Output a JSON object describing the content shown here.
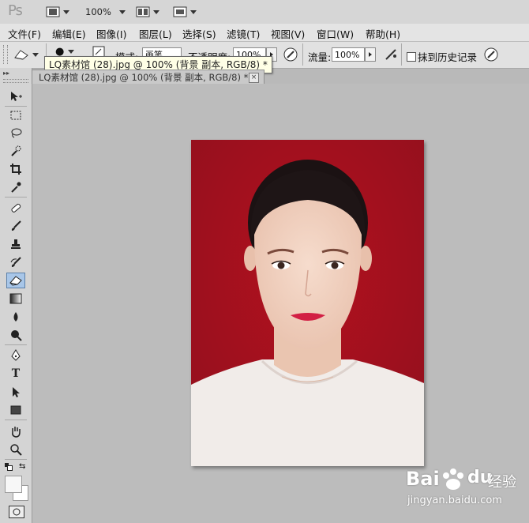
{
  "app": {
    "logo": "Ps",
    "zoom": "100%"
  },
  "menu": [
    "文件(F)",
    "编辑(E)",
    "图像(I)",
    "图层(L)",
    "选择(S)",
    "滤镜(T)",
    "视图(V)",
    "窗口(W)",
    "帮助(H)"
  ],
  "options": {
    "brush_size": "●",
    "mode_label": "模式:",
    "mode_value": "画笔",
    "opacity_label": "不透明度:",
    "opacity_value": "100%",
    "flow_label": "流量:",
    "flow_value": "100%",
    "history_label": "抹到历史记录"
  },
  "tooltip": "LQ素材馆 (28).jpg @ 100% (背景 副本, RGB/8) *",
  "document": {
    "tab_title": "LQ素材馆 (28).jpg @ 100% (背景 副本, RGB/8) *",
    "close": "×",
    "background_color": "#a40f1e"
  },
  "watermark": {
    "brand_latin": "Bai",
    "brand_du": "du",
    "brand_cn": "经验",
    "url": "jingyan.baidu.com"
  },
  "colors": {
    "accent": "#a40f1e",
    "active_tool": "#a8c6e8"
  }
}
